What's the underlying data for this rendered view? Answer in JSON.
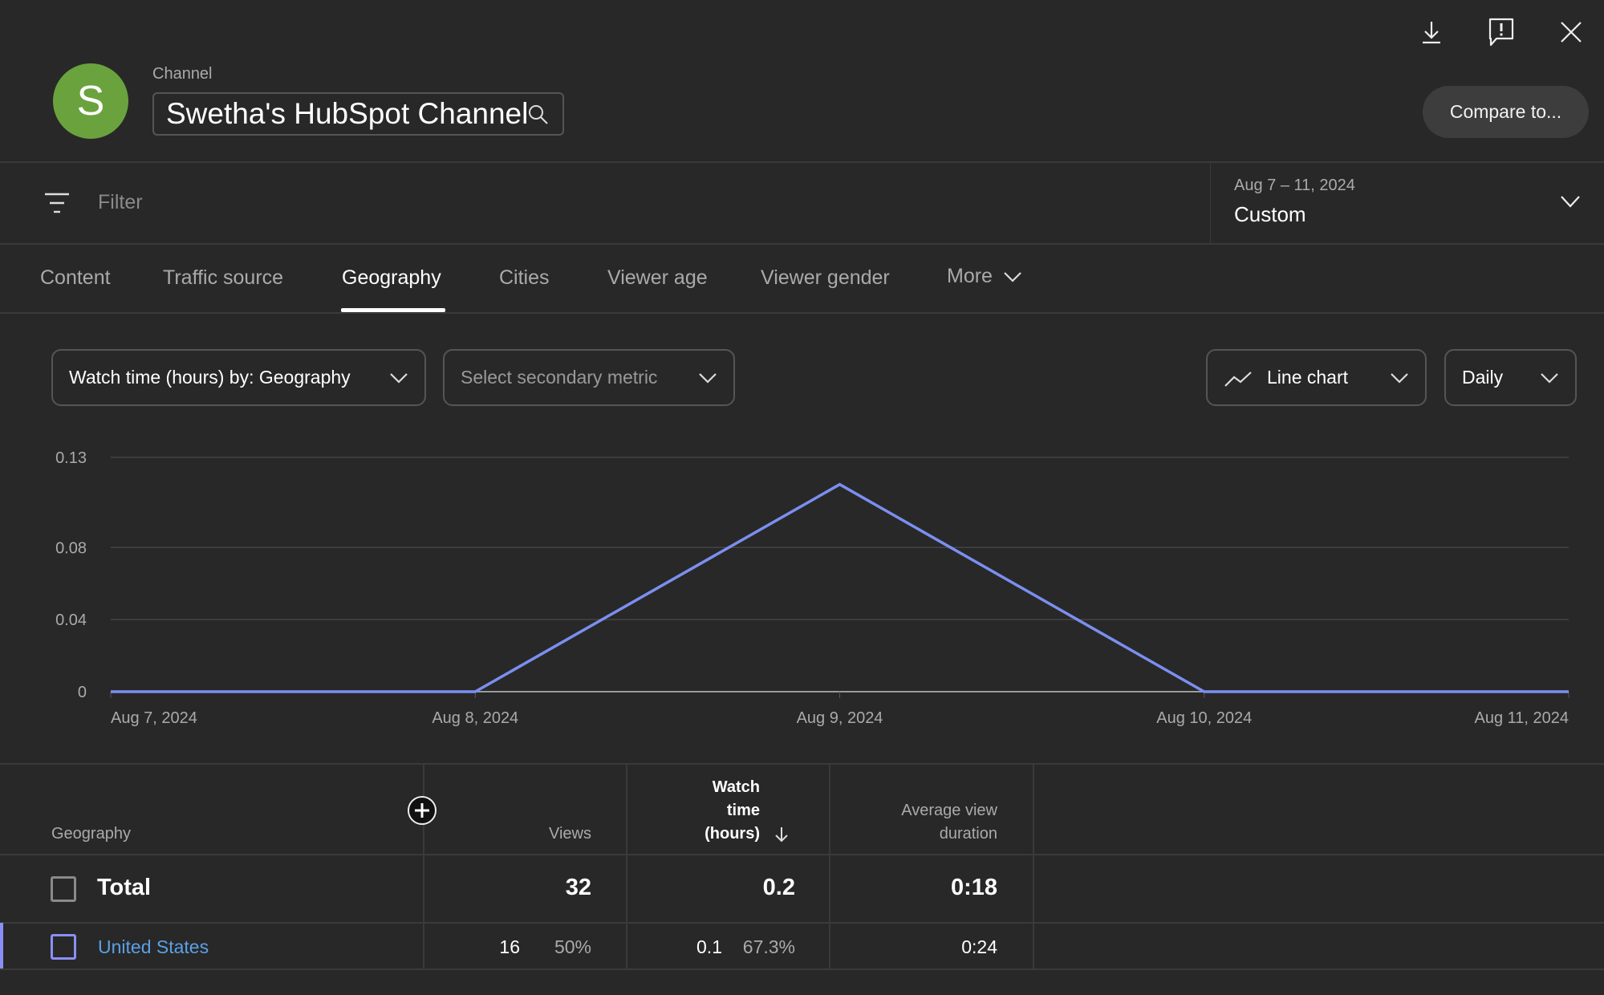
{
  "header": {
    "avatar_letter": "S",
    "avatar_color": "#6aa33d",
    "channel_label": "Channel",
    "channel_name": "Swetha's HubSpot Channel",
    "compare_button": "Compare to...",
    "icons": [
      "download-icon",
      "feedback-icon",
      "close-icon"
    ]
  },
  "filter": {
    "placeholder": "Filter",
    "date_range": "Aug 7 – 11, 2024",
    "date_preset": "Custom"
  },
  "tabs": [
    {
      "label": "Content",
      "active": false
    },
    {
      "label": "Traffic source",
      "active": false
    },
    {
      "label": "Geography",
      "active": true
    },
    {
      "label": "Cities",
      "active": false
    },
    {
      "label": "Viewer age",
      "active": false
    },
    {
      "label": "Viewer gender",
      "active": false
    },
    {
      "label": "More",
      "active": false
    }
  ],
  "controls": {
    "primary_metric": "Watch time (hours) by: Geography",
    "secondary_metric_placeholder": "Select secondary metric",
    "chart_type": "Line chart",
    "granularity": "Daily"
  },
  "chart_data": {
    "type": "line",
    "title": "",
    "xlabel": "",
    "ylabel": "Watch time (hours)",
    "x": [
      "Aug 7, 2024",
      "Aug 8, 2024",
      "Aug 9, 2024",
      "Aug 10, 2024",
      "Aug 11, 2024"
    ],
    "series": [
      {
        "name": "United States",
        "color": "#7b8ff0",
        "values": [
          0,
          0,
          0.115,
          0,
          0
        ]
      }
    ],
    "yticks": [
      0,
      0.04,
      0.08,
      0.13
    ],
    "ytick_labels": [
      "0",
      "0.04",
      "0.08",
      "0.13"
    ],
    "ylim": [
      0,
      0.13
    ],
    "grid": true,
    "legend": "none"
  },
  "table": {
    "columns": {
      "geography": "Geography",
      "views": "Views",
      "watch_time_lines": [
        "Watch",
        "time",
        "(hours)"
      ],
      "avg_duration_lines": [
        "Average view",
        "duration"
      ]
    },
    "sort_indicator": "arrow-down-icon",
    "total": {
      "label": "Total",
      "views": "32",
      "watch_time": "0.2",
      "avg_duration": "0:18"
    },
    "rows": [
      {
        "geography": "United States",
        "views": "16",
        "views_pct": "50%",
        "watch_time": "0.1",
        "watch_time_pct": "67.3%",
        "avg_duration": "0:24"
      }
    ]
  }
}
